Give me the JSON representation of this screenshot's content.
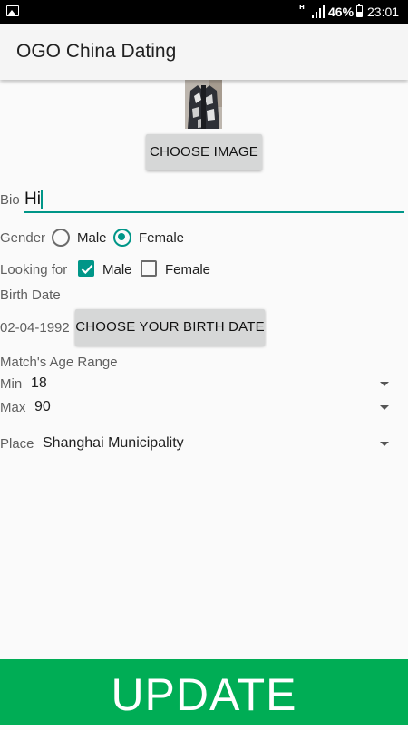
{
  "status_bar": {
    "network": "H",
    "battery": "46%",
    "time": "23:01"
  },
  "app": {
    "title": "OGO China Dating"
  },
  "profile": {
    "choose_image_label": "CHOOSE IMAGE"
  },
  "form": {
    "bio_label": "Bio",
    "bio_value": "Hi",
    "gender_label": "Gender",
    "gender_options": [
      {
        "label": "Male",
        "selected": false
      },
      {
        "label": "Female",
        "selected": true
      }
    ],
    "looking_for_label": "Looking for",
    "looking_for_options": [
      {
        "label": "Male",
        "checked": true
      },
      {
        "label": "Female",
        "checked": false
      }
    ],
    "birth_date_label": "Birth Date",
    "birth_date_value": "02-04-1992",
    "birth_date_button": "CHOOSE YOUR BIRTH DATE",
    "age_range_label": "Match's Age Range",
    "min_label": "Min",
    "min_value": "18",
    "max_label": "Max",
    "max_value": "90",
    "place_label": "Place",
    "place_value": "Shanghai Municipality"
  },
  "update_label": "UPDATE",
  "colors": {
    "accent": "#009688",
    "update_bg": "#00ad55",
    "button_bg": "#d6d7d7"
  },
  "icons": [
    "gallery-icon",
    "signal-icon",
    "battery-icon",
    "dropdown-arrow-icon",
    "check-icon"
  ]
}
